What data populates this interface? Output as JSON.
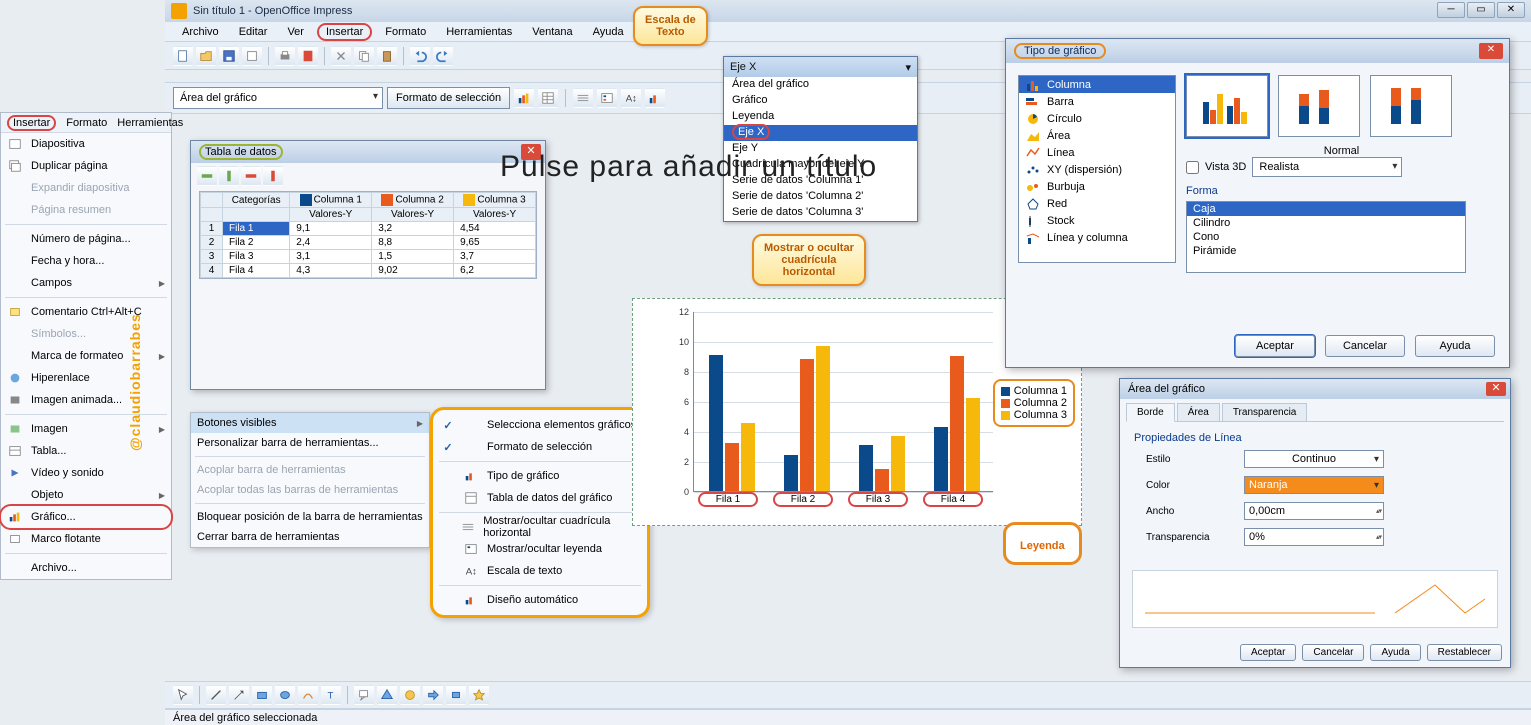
{
  "app": {
    "title": "Sin título 1 - OpenOffice Impress"
  },
  "menubar": [
    "Archivo",
    "Editar",
    "Ver",
    "Insertar",
    "Formato",
    "Herramientas",
    "Ventana",
    "Ayuda"
  ],
  "chart_toolbar": {
    "area": "Área del gráfico",
    "format_sel": "Formato de selección"
  },
  "dropdown": {
    "head": "Eje X",
    "items": [
      "Área del gráfico",
      "Gráfico",
      "Leyenda",
      "Eje X",
      "Eje Y",
      "Cuadrícula mayor del eje Y",
      "Serie de datos 'Columna 1'",
      "Serie de datos 'Columna 2'",
      "Serie de datos 'Columna 3'"
    ]
  },
  "insert_panel": {
    "header": [
      "Insertar",
      "Formato",
      "Herramientas"
    ],
    "items": [
      {
        "lbl": "Diapositiva"
      },
      {
        "lbl": "Duplicar página"
      },
      {
        "lbl": "Expandir diapositiva",
        "dis": true
      },
      {
        "lbl": "Página resumen",
        "dis": true
      },
      {
        "lbl": "Número de página..."
      },
      {
        "lbl": "Fecha y hora..."
      },
      {
        "lbl": "Campos",
        "arrow": true
      },
      {
        "lbl": "Comentario   Ctrl+Alt+C"
      },
      {
        "lbl": "Símbolos...",
        "dis": true
      },
      {
        "lbl": "Marca de formateo",
        "arrow": true
      },
      {
        "lbl": "Hiperenlace"
      },
      {
        "lbl": "Imagen animada..."
      },
      {
        "lbl": "Imagen",
        "arrow": true
      },
      {
        "lbl": "Tabla..."
      },
      {
        "lbl": "Vídeo y sonido"
      },
      {
        "lbl": "Objeto",
        "arrow": true
      },
      {
        "lbl": "Gráfico...",
        "hl": true
      },
      {
        "lbl": "Marco flotante"
      },
      {
        "lbl": "Archivo..."
      }
    ]
  },
  "ctx1": [
    {
      "lbl": "Botones visibles",
      "arrow": true,
      "sel": true
    },
    {
      "lbl": "Personalizar barra de herramientas..."
    },
    {
      "lbl": "Acoplar barra de herramientas",
      "dis": true
    },
    {
      "lbl": "Acoplar todas las barras de herramientas",
      "dis": true
    },
    {
      "lbl": "Bloquear posición de la barra de herramientas"
    },
    {
      "lbl": "Cerrar barra de herramientas"
    }
  ],
  "ctx2": [
    {
      "chk": true,
      "lbl": "Selecciona elementos gráficos"
    },
    {
      "chk": true,
      "lbl": "Formato de selección"
    },
    {
      "lbl": "Tipo de gráfico"
    },
    {
      "lbl": "Tabla de datos del gráfico"
    },
    {
      "lbl": "Mostrar/ocultar cuadrícula horizontal"
    },
    {
      "lbl": "Mostrar/ocultar leyenda"
    },
    {
      "lbl": "Escala de texto"
    },
    {
      "lbl": "Diseño automático"
    }
  ],
  "datawin": {
    "title": "Tabla de datos",
    "cols": [
      "Categorías",
      "Columna 1",
      "Columna 2",
      "Columna 3"
    ],
    "subcols": [
      "",
      "Valores-Y",
      "Valores-Y",
      "Valores-Y"
    ],
    "rows": [
      [
        "Fila 1",
        "9,1",
        "3,2",
        "4,54"
      ],
      [
        "Fila 2",
        "2,4",
        "8,8",
        "9,65"
      ],
      [
        "Fila 3",
        "3,1",
        "1,5",
        "3,7"
      ],
      [
        "Fila 4",
        "4,3",
        "9,02",
        "6,2"
      ]
    ]
  },
  "slide": {
    "title_placeholder": "Pulse para añadir un título"
  },
  "callouts": {
    "escala": "Escala de\nTexto",
    "mostrar": "Mostrar o ocultar\ncuadrícula\nhorizontal",
    "leyenda": "Leyenda"
  },
  "chart_data": {
    "type": "bar",
    "categories": [
      "Fila 1",
      "Fila 2",
      "Fila 3",
      "Fila 4"
    ],
    "series": [
      {
        "name": "Columna 1",
        "values": [
          9.1,
          2.4,
          3.1,
          4.3
        ],
        "color": "#0b4a8a"
      },
      {
        "name": "Columna 2",
        "values": [
          3.2,
          8.8,
          1.5,
          9.02
        ],
        "color": "#e85b1d"
      },
      {
        "name": "Columna 3",
        "values": [
          4.54,
          9.65,
          3.7,
          6.2
        ],
        "color": "#f7b80c"
      }
    ],
    "ylim": [
      0,
      12
    ],
    "yticks": [
      0,
      2,
      4,
      6,
      8,
      10,
      12
    ],
    "title": "",
    "xlabel": "",
    "ylabel": ""
  },
  "ctype": {
    "title": "Tipo de gráfico",
    "types": [
      "Columna",
      "Barra",
      "Círculo",
      "Área",
      "Línea",
      "XY (dispersión)",
      "Burbuja",
      "Red",
      "Stock",
      "Línea y columna"
    ],
    "subtype": "Normal",
    "vista3d": "Vista 3D",
    "look": "Realista",
    "shape_lbl": "Forma",
    "shapes": [
      "Caja",
      "Cilindro",
      "Cono",
      "Pirámide"
    ],
    "btns": [
      "Aceptar",
      "Cancelar",
      "Ayuda"
    ]
  },
  "areadlg": {
    "title": "Área del gráfico",
    "tabs": [
      "Borde",
      "Área",
      "Transparencia"
    ],
    "section": "Propiedades de Línea",
    "estilo_lbl": "Estilo",
    "estilo": "Continuo",
    "color_lbl": "Color",
    "color": "Naranja",
    "ancho_lbl": "Ancho",
    "ancho": "0,00cm",
    "trans_lbl": "Transparencia",
    "trans": "0%",
    "btns": [
      "Aceptar",
      "Cancelar",
      "Ayuda",
      "Restablecer"
    ]
  },
  "status": "Área del gráfico seleccionada",
  "watermark": "@claudiobarrabes"
}
